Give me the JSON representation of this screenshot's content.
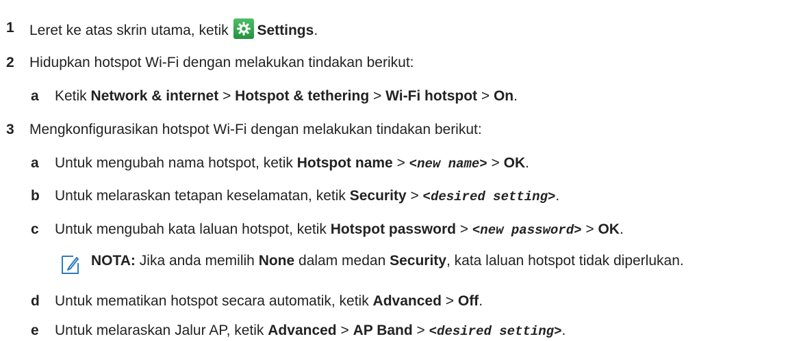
{
  "steps": [
    {
      "num": "1",
      "pre": "Leret ke atas skrin utama, ketik ",
      "icon": "settings-gear-icon",
      "bold": "Settings",
      "post": "."
    },
    {
      "num": "2",
      "text": "Hidupkan hotspot Wi-Fi dengan melakukan tindakan berikut:"
    },
    {
      "num": "3",
      "text": "Mengkonfigurasikan hotspot Wi-Fi dengan melakukan tindakan berikut:"
    }
  ],
  "step2_sub": {
    "a": {
      "letter": "a",
      "pre": "Ketik ",
      "p1": "Network & internet",
      "sep1": " > ",
      "p2": "Hotspot & tethering",
      "sep2": " > ",
      "p3": "Wi-Fi hotspot",
      "sep3": " > ",
      "p4": "On",
      "end": "."
    }
  },
  "step3_sub": {
    "a": {
      "letter": "a",
      "pre": "Untuk mengubah nama hotspot, ketik ",
      "b1": "Hotspot name",
      "sep1": " > ",
      "m1": "<new name>",
      "sep2": " > ",
      "b2": "OK",
      "end": "."
    },
    "b": {
      "letter": "b",
      "pre": "Untuk melaraskan tetapan keselamatan, ketik ",
      "b1": "Security",
      "sep1": " > ",
      "m1": "<desired setting>",
      "end": "."
    },
    "c": {
      "letter": "c",
      "pre": "Untuk mengubah kata laluan hotspot, ketik ",
      "b1": "Hotspot password",
      "sep1": " > ",
      "m1": "<new password>",
      "sep2": " > ",
      "b2": "OK",
      "end": "."
    },
    "d": {
      "letter": "d",
      "pre": "Untuk mematikan hotspot secara automatik, ketik ",
      "b1": "Advanced",
      "sep1": " > ",
      "b2": "Off",
      "end": "."
    },
    "e": {
      "letter": "e",
      "pre": "Untuk melaraskan Jalur AP, ketik ",
      "b1": "Advanced",
      "sep1": " > ",
      "b2": "AP Band",
      "sep2": " > ",
      "m1": "<desired setting>",
      "end": "."
    }
  },
  "note": {
    "icon": "pencil-note-icon",
    "label": "NOTA:",
    "t1": " Jika anda memilih ",
    "b1": "None",
    "t2": " dalam medan ",
    "b2": "Security",
    "t3": ", kata laluan hotspot tidak diperlukan."
  },
  "colors": {
    "icon_blue": "#2e7bbd",
    "settings_green": "#2fa84f",
    "text": "#222222"
  }
}
